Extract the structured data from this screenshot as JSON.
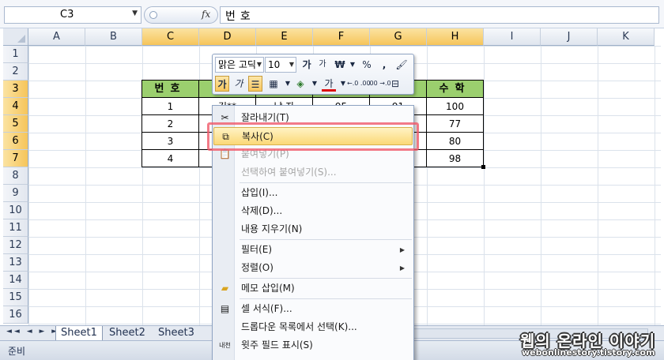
{
  "formula_bar": {
    "name_box": "C3",
    "fx_label": "fx",
    "formula_value": "번호"
  },
  "columns": [
    "A",
    "B",
    "C",
    "D",
    "E",
    "F",
    "G",
    "H",
    "I",
    "J",
    "K"
  ],
  "rows": [
    "1",
    "2",
    "3",
    "4",
    "5",
    "6",
    "7",
    "8",
    "9",
    "10",
    "11",
    "12",
    "13",
    "14",
    "15",
    "16"
  ],
  "selected_column_labels": [
    "C",
    "D",
    "E",
    "F",
    "G",
    "H"
  ],
  "selected_row_labels": [
    "3",
    "4",
    "5",
    "6",
    "7"
  ],
  "table": {
    "header": {
      "c": "번호",
      "d": "이",
      "g": "ㅓ",
      "h": "수학"
    },
    "rows": [
      {
        "c": "1",
        "d": "김**",
        "e": "남 자",
        "f": "95",
        "g": "91",
        "h": "100"
      },
      {
        "c": "2",
        "h": "77"
      },
      {
        "c": "3",
        "h": "80"
      },
      {
        "c": "4",
        "h": "98"
      }
    ],
    "header_color": "#9bcf6e"
  },
  "mini_toolbar": {
    "font_name": "맑은 고딕",
    "font_size": "10",
    "grow_font": "가",
    "shrink_font": "가",
    "currency": "₩",
    "percent": "%",
    "comma": ",",
    "bold": "가",
    "italic": "가",
    "font_color_letter": "가",
    "decimal_inc": "←.0 .00",
    "decimal_dec": ".00 →.0"
  },
  "context_menu": {
    "items": [
      {
        "label": "잘라내기(T)",
        "icon": "scissors-icon",
        "enabled": true
      },
      {
        "label": "복사(C)",
        "icon": "copy-icon",
        "enabled": true,
        "highlighted": true
      },
      {
        "label": "붙여넣기(P)",
        "icon": "paste-icon",
        "enabled": false
      },
      {
        "label": "선택하여 붙여넣기(S)...",
        "enabled": false
      },
      {
        "label": "삽입(I)...",
        "enabled": true
      },
      {
        "label": "삭제(D)...",
        "enabled": true
      },
      {
        "label": "내용 지우기(N)",
        "enabled": true
      },
      {
        "label": "필터(E)",
        "enabled": true,
        "submenu": true
      },
      {
        "label": "정렬(O)",
        "enabled": true,
        "submenu": true
      },
      {
        "label": "메모 삽입(M)",
        "icon": "comment-icon",
        "enabled": true
      },
      {
        "label": "셀 서식(F)...",
        "icon": "format-cells-icon",
        "enabled": true
      },
      {
        "label": "드롭다운 목록에서 선택(K)...",
        "enabled": true
      },
      {
        "label": "윗주 필드 표시(S)",
        "icon": "phonetic-icon",
        "enabled": true
      }
    ],
    "phonetic_icon_text": "내천",
    "highlight_color": "#f05a6a"
  },
  "sheet_tabs": [
    "Sheet1",
    "Sheet2",
    "Sheet3"
  ],
  "nav_arrows": "◄◄ ◄ ► ►►",
  "status": "준비",
  "watermark": {
    "title": "웹의 온라인 이야기",
    "url": "webonlinestory.tistory.com"
  }
}
